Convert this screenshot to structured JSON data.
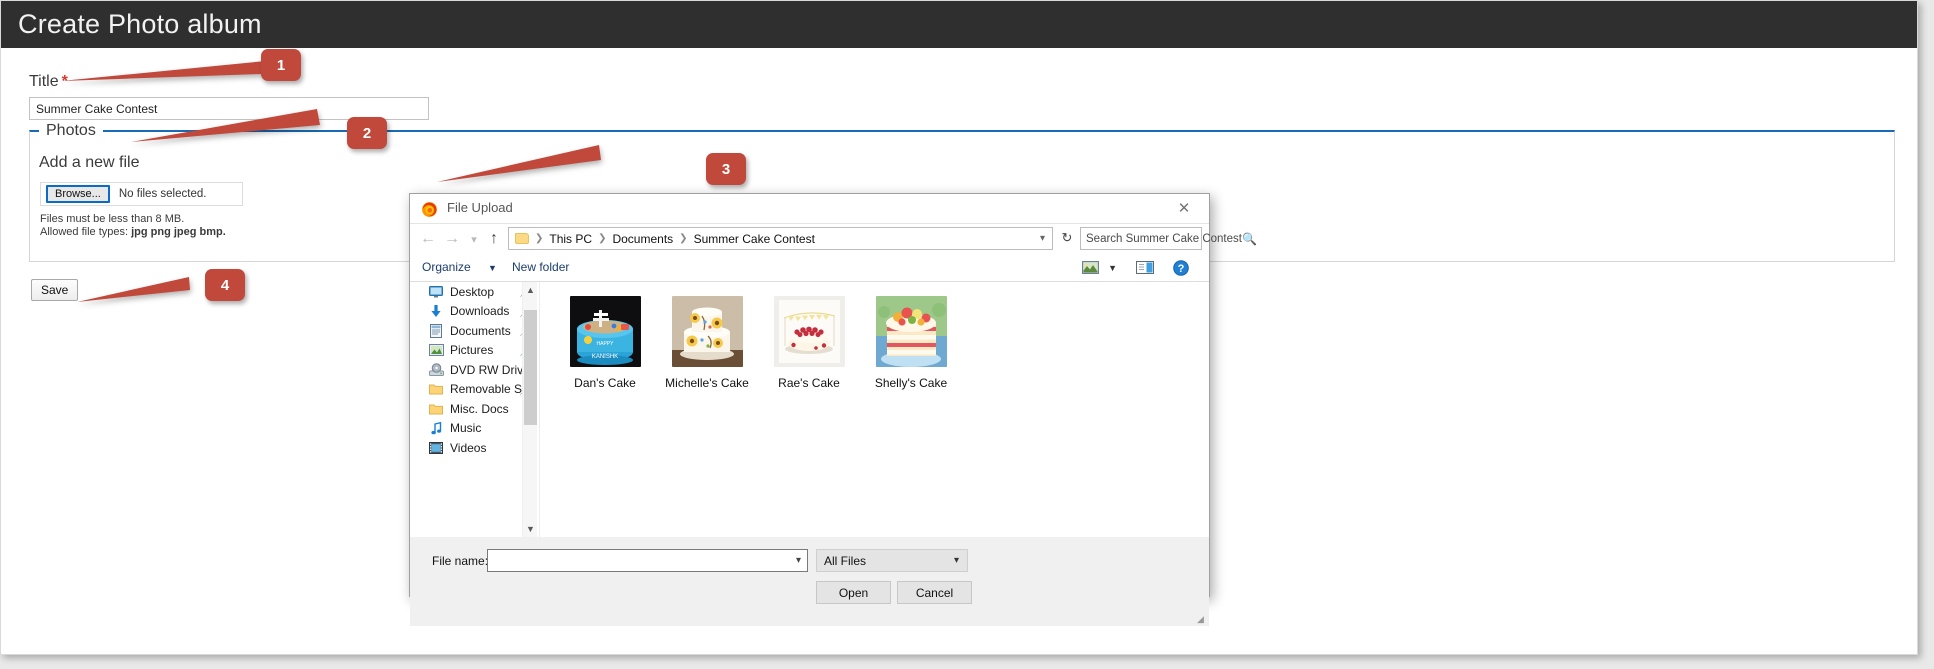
{
  "header": {
    "title": "Create Photo album"
  },
  "form": {
    "title_label": "Title",
    "required_mark": "*",
    "title_value": "Summer Cake Contest",
    "photos_legend": "Photos",
    "add_file_label": "Add a new file",
    "browse_button": "Browse...",
    "no_files_text": "No files selected.",
    "hint_size": "Files must be less than 8 MB.",
    "hint_types_prefix": "Allowed file types: ",
    "hint_types_value": "jpg png jpeg bmp.",
    "save_button": "Save"
  },
  "callouts": [
    {
      "number": "1"
    },
    {
      "number": "2"
    },
    {
      "number": "3"
    },
    {
      "number": "4"
    }
  ],
  "file_dialog": {
    "title": "File Upload",
    "close_icon": "close-icon",
    "nav": {
      "back_icon": "back-arrow-icon",
      "forward_icon": "forward-arrow-icon",
      "recent_icon": "chevron-down-icon",
      "up_icon": "up-arrow-icon",
      "refresh_icon": "refresh-icon"
    },
    "breadcrumbs": [
      "This PC",
      "Documents",
      "Summer Cake Contest"
    ],
    "search_placeholder": "Search Summer Cake Contest",
    "search_icon": "search-icon",
    "commands": {
      "organize": "Organize",
      "new_folder": "New folder",
      "layout_icon": "layout-view-icon",
      "pane_icon": "preview-pane-icon",
      "help_icon": "help-icon"
    },
    "sidebar": [
      {
        "label": "Desktop",
        "icon": "desktop-icon",
        "pinned": true
      },
      {
        "label": "Downloads",
        "icon": "download-icon",
        "pinned": true
      },
      {
        "label": "Documents",
        "icon": "document-icon",
        "pinned": true
      },
      {
        "label": "Pictures",
        "icon": "pictures-icon",
        "pinned": true
      },
      {
        "label": "DVD RW Drive",
        "icon": "dvd-drive-icon",
        "pinned": true
      },
      {
        "label": "Removable St",
        "icon": "folder-icon",
        "pinned": true
      },
      {
        "label": "Misc. Docs",
        "icon": "folder-icon",
        "pinned": false
      },
      {
        "label": "Music",
        "icon": "music-icon",
        "pinned": false
      },
      {
        "label": "Videos",
        "icon": "video-icon",
        "pinned": false
      }
    ],
    "files": [
      {
        "name": "Dan's Cake"
      },
      {
        "name": "Michelle's Cake"
      },
      {
        "name": "Rae's Cake"
      },
      {
        "name": "Shelly's Cake"
      }
    ],
    "footer": {
      "file_name_label": "File name:",
      "file_name_value": "",
      "filter_value": "All Files",
      "open_button": "Open",
      "cancel_button": "Cancel"
    }
  },
  "colors": {
    "header_bg": "#2f2f2f",
    "accent_blue": "#1a6bb5",
    "callout_red": "#c0493c",
    "required_red": "#d93a2b"
  }
}
